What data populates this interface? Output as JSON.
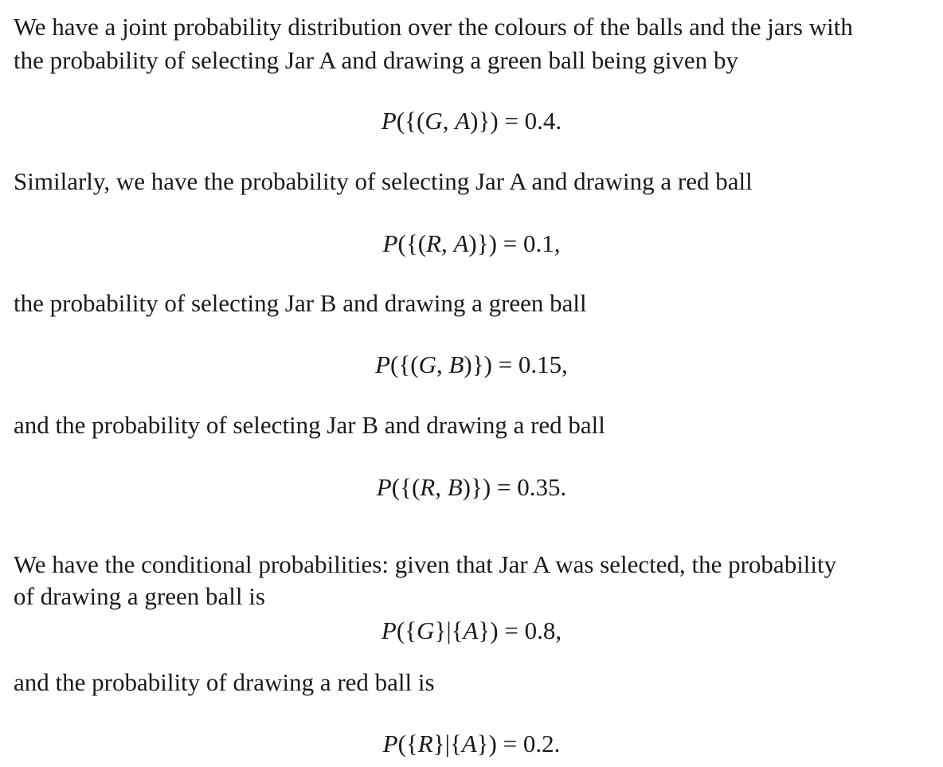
{
  "paragraphs": [
    "We have a joint probability distribution over the colours of the balls and the jars with",
    "the probability of selecting Jar A and drawing a green ball being given by",
    "Similarly, we have the probability of selecting Jar A and drawing a red ball",
    "the probability of selecting Jar B and drawing a green ball",
    "and the probability of selecting Jar B and drawing a red ball",
    "We have the conditional probabilities: given that Jar A was selected, the probability",
    "of drawing a green ball is",
    "and the probability of drawing a red ball is"
  ],
  "equations": [
    "P({(G, A)}) = 0.4.",
    "P({(R, A)}) = 0.1,",
    "P({(G, B)}) = 0.15,",
    "P({(R, B)}) = 0.35.",
    "P({G}|{A}) = 0.8,",
    "P({R}|{A}) = 0.2."
  ]
}
